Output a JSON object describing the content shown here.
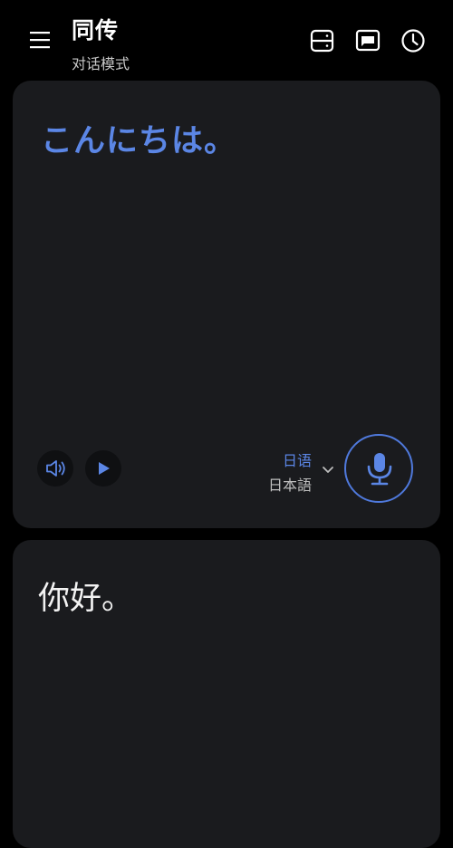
{
  "header": {
    "title": "同传",
    "subtitle": "对话模式",
    "icons": [
      "menu-icon",
      "split-screen-icon",
      "message-icon",
      "history-icon"
    ]
  },
  "source_card": {
    "text": "こんにちは。",
    "language_label": "日语",
    "language_native": "日本語",
    "icons": [
      "speaker-icon",
      "play-icon",
      "chevron-down-icon",
      "microphone-icon"
    ]
  },
  "target_card": {
    "text": "你好。"
  },
  "colors": {
    "accent": "#5b86e5",
    "card_background": "#1a1b1e",
    "page_background": "#000000"
  }
}
